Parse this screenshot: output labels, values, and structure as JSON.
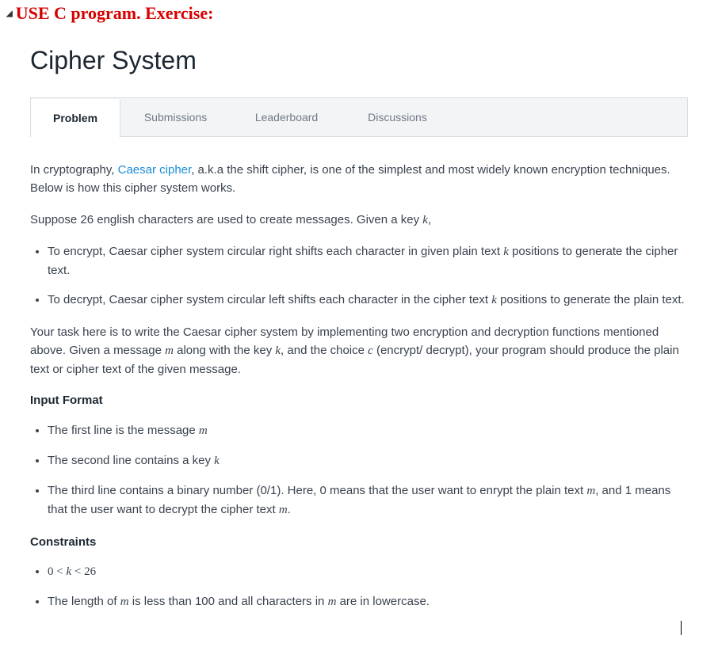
{
  "instruction": {
    "text": "USE C program. Exercise:"
  },
  "title": "Cipher System",
  "tabs": [
    {
      "label": "Problem",
      "active": true
    },
    {
      "label": "Submissions",
      "active": false
    },
    {
      "label": "Leaderboard",
      "active": false
    },
    {
      "label": "Discussions",
      "active": false
    }
  ],
  "intro": {
    "pre": "In cryptography, ",
    "link": "Caesar cipher",
    "post": ", a.k.a the shift cipher, is one of the simplest and most widely known encryption techniques. Below is how this cipher system works."
  },
  "suppose": {
    "pre": "Suppose 26 english characters are used to create messages. Given a key ",
    "k": "k",
    "post": ","
  },
  "encrypt_bullet": {
    "pre": "To encrypt, Caesar cipher system circular right shifts each character in given plain text ",
    "k": "k",
    "post": " positions to generate the cipher text."
  },
  "decrypt_bullet": {
    "pre": "To decrypt, Caesar cipher system circular left shifts each character in the cipher text ",
    "k": "k",
    "post": " positions to generate the plain text."
  },
  "task": {
    "p1": "Your task here is to write the Caesar cipher system by implementing two encryption and decryption functions mentioned above. Given a message ",
    "m": "m",
    "p2": " along with the key ",
    "k": "k",
    "p3": ", and the choice ",
    "c": "c",
    "p4": " (encrypt/ decrypt), your program should produce the plain text or cipher text of the given message."
  },
  "headings": {
    "input": "Input Format",
    "constraints": "Constraints"
  },
  "input_items": {
    "line1": {
      "pre": "The first line is the message ",
      "m": "m"
    },
    "line2": {
      "pre": "The second line contains a key ",
      "k": "k"
    },
    "line3": {
      "pre": "The third line contains a binary number (0/1). Here, 0 means that the user want to enrypt the plain text ",
      "m1": "m",
      "mid": ", and 1 means that the user want to decrypt the cipher text ",
      "m2": "m",
      "post": "."
    }
  },
  "constraints": {
    "k_range": "0 < k < 26",
    "len": {
      "pre": "The length of ",
      "m1": "m",
      "mid": " is less than 100 and all characters in ",
      "m2": "m",
      "post": " are in lowercase."
    }
  }
}
